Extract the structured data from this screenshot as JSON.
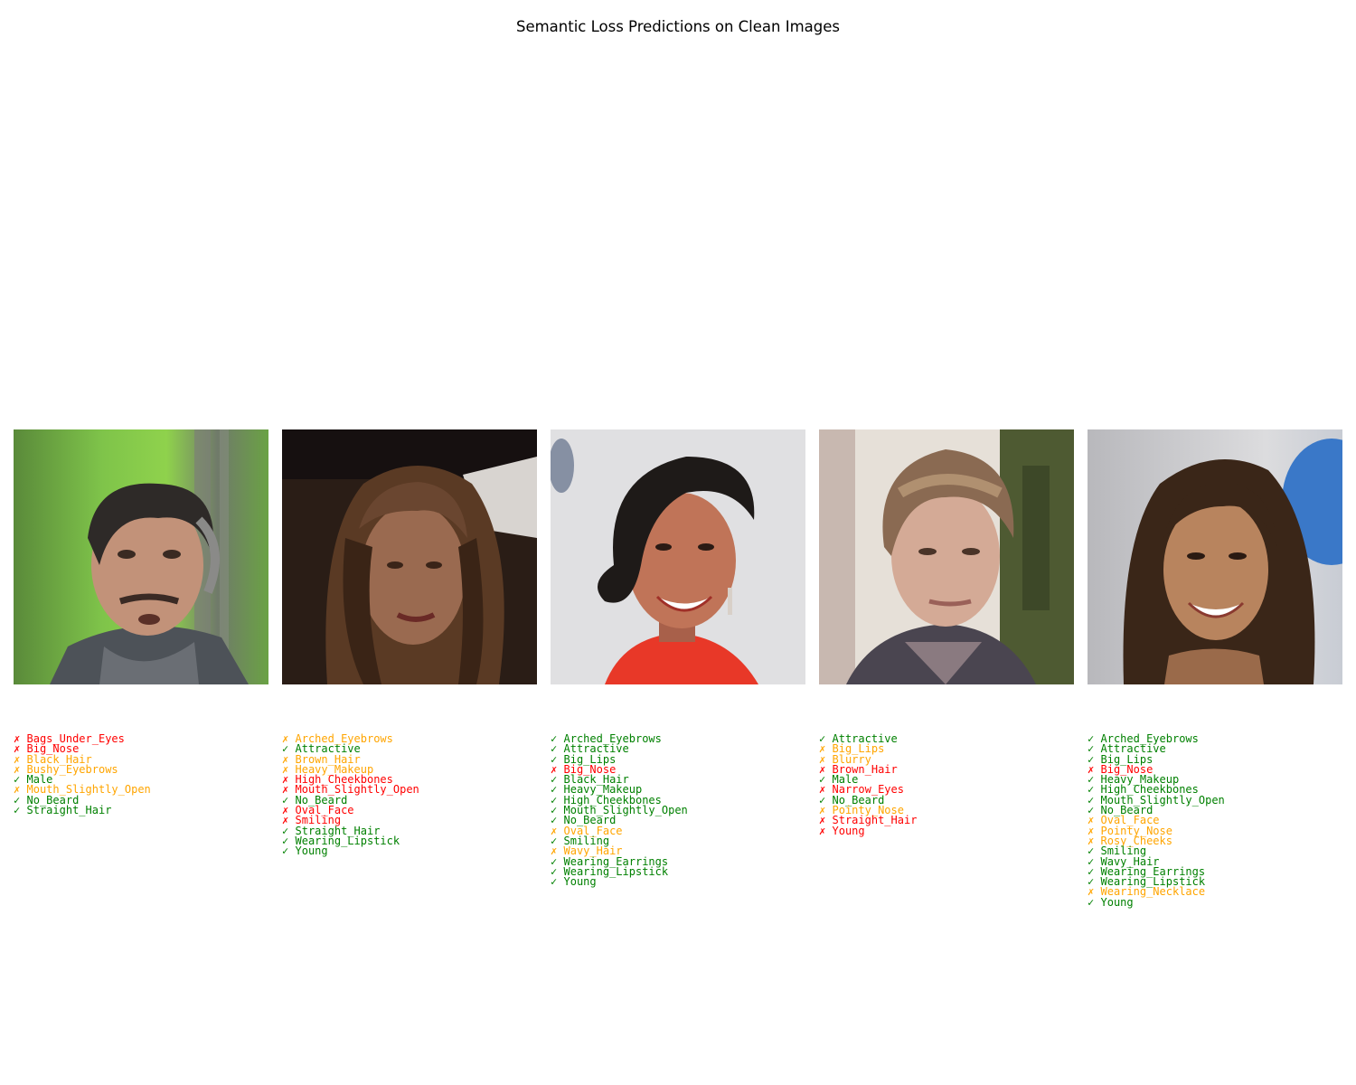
{
  "title": "Semantic Loss Predictions on Clean Images",
  "colors": {
    "correct": "#008000",
    "partial": "#ffa500",
    "wrong": "#ff0000"
  },
  "chart_data": {
    "type": "image-grid",
    "title": "Semantic Loss Predictions on Clean Images",
    "legend": "none",
    "panels": [
      {
        "image": "face-photo-older-man",
        "labels": [
          {
            "mark": "✗",
            "text": "Bags_Under_Eyes",
            "status": "wrong"
          },
          {
            "mark": "✗",
            "text": "Big_Nose",
            "status": "wrong"
          },
          {
            "mark": "✗",
            "text": "Black_Hair",
            "status": "partial"
          },
          {
            "mark": "✗",
            "text": "Bushy_Eyebrows",
            "status": "partial"
          },
          {
            "mark": "✓",
            "text": "Male",
            "status": "correct"
          },
          {
            "mark": "✗",
            "text": "Mouth_Slightly_Open",
            "status": "partial"
          },
          {
            "mark": "✓",
            "text": "No_Beard",
            "status": "correct"
          },
          {
            "mark": "✓",
            "text": "Straight_Hair",
            "status": "correct"
          }
        ]
      },
      {
        "image": "face-photo-young-woman-long-hair",
        "labels": [
          {
            "mark": "✗",
            "text": "Arched_Eyebrows",
            "status": "partial"
          },
          {
            "mark": "✓",
            "text": "Attractive",
            "status": "correct"
          },
          {
            "mark": "✗",
            "text": "Brown_Hair",
            "status": "partial"
          },
          {
            "mark": "✗",
            "text": "Heavy_Makeup",
            "status": "partial"
          },
          {
            "mark": "✗",
            "text": "High_Cheekbones",
            "status": "wrong"
          },
          {
            "mark": "✗",
            "text": "Mouth_Slightly_Open",
            "status": "wrong"
          },
          {
            "mark": "✓",
            "text": "No_Beard",
            "status": "correct"
          },
          {
            "mark": "✗",
            "text": "Oval_Face",
            "status": "wrong"
          },
          {
            "mark": "✗",
            "text": "Smiling",
            "status": "wrong"
          },
          {
            "mark": "✓",
            "text": "Straight_Hair",
            "status": "correct"
          },
          {
            "mark": "✓",
            "text": "Wearing_Lipstick",
            "status": "correct"
          },
          {
            "mark": "✓",
            "text": "Young",
            "status": "correct"
          }
        ]
      },
      {
        "image": "face-photo-smiling-woman-red-top",
        "labels": [
          {
            "mark": "✓",
            "text": "Arched_Eyebrows",
            "status": "correct"
          },
          {
            "mark": "✓",
            "text": "Attractive",
            "status": "correct"
          },
          {
            "mark": "✓",
            "text": "Big_Lips",
            "status": "correct"
          },
          {
            "mark": "✗",
            "text": "Big_Nose",
            "status": "wrong"
          },
          {
            "mark": "✓",
            "text": "Black_Hair",
            "status": "correct"
          },
          {
            "mark": "✓",
            "text": "Heavy_Makeup",
            "status": "correct"
          },
          {
            "mark": "✓",
            "text": "High_Cheekbones",
            "status": "correct"
          },
          {
            "mark": "✓",
            "text": "Mouth_Slightly_Open",
            "status": "correct"
          },
          {
            "mark": "✓",
            "text": "No_Beard",
            "status": "correct"
          },
          {
            "mark": "✗",
            "text": "Oval_Face",
            "status": "partial"
          },
          {
            "mark": "✓",
            "text": "Smiling",
            "status": "correct"
          },
          {
            "mark": "✗",
            "text": "Wavy_Hair",
            "status": "partial"
          },
          {
            "mark": "✓",
            "text": "Wearing_Earrings",
            "status": "correct"
          },
          {
            "mark": "✓",
            "text": "Wearing_Lipstick",
            "status": "correct"
          },
          {
            "mark": "✓",
            "text": "Young",
            "status": "correct"
          }
        ]
      },
      {
        "image": "face-photo-young-man",
        "labels": [
          {
            "mark": "✓",
            "text": "Attractive",
            "status": "correct"
          },
          {
            "mark": "✗",
            "text": "Big_Lips",
            "status": "partial"
          },
          {
            "mark": "✗",
            "text": "Blurry",
            "status": "partial"
          },
          {
            "mark": "✗",
            "text": "Brown_Hair",
            "status": "wrong"
          },
          {
            "mark": "✓",
            "text": "Male",
            "status": "correct"
          },
          {
            "mark": "✗",
            "text": "Narrow_Eyes",
            "status": "wrong"
          },
          {
            "mark": "✓",
            "text": "No_Beard",
            "status": "correct"
          },
          {
            "mark": "✗",
            "text": "Pointy_Nose",
            "status": "partial"
          },
          {
            "mark": "✗",
            "text": "Straight_Hair",
            "status": "wrong"
          },
          {
            "mark": "✗",
            "text": "Young",
            "status": "wrong"
          }
        ]
      },
      {
        "image": "face-photo-smiling-woman-wavy-hair",
        "labels": [
          {
            "mark": "✓",
            "text": "Arched_Eyebrows",
            "status": "correct"
          },
          {
            "mark": "✓",
            "text": "Attractive",
            "status": "correct"
          },
          {
            "mark": "✓",
            "text": "Big_Lips",
            "status": "correct"
          },
          {
            "mark": "✗",
            "text": "Big_Nose",
            "status": "wrong"
          },
          {
            "mark": "✓",
            "text": "Heavy_Makeup",
            "status": "correct"
          },
          {
            "mark": "✓",
            "text": "High_Cheekbones",
            "status": "correct"
          },
          {
            "mark": "✓",
            "text": "Mouth_Slightly_Open",
            "status": "correct"
          },
          {
            "mark": "✓",
            "text": "No_Beard",
            "status": "correct"
          },
          {
            "mark": "✗",
            "text": "Oval_Face",
            "status": "partial"
          },
          {
            "mark": "✗",
            "text": "Pointy_Nose",
            "status": "partial"
          },
          {
            "mark": "✗",
            "text": "Rosy_Cheeks",
            "status": "partial"
          },
          {
            "mark": "✓",
            "text": "Smiling",
            "status": "correct"
          },
          {
            "mark": "✓",
            "text": "Wavy_Hair",
            "status": "correct"
          },
          {
            "mark": "✓",
            "text": "Wearing_Earrings",
            "status": "correct"
          },
          {
            "mark": "✓",
            "text": "Wearing_Lipstick",
            "status": "correct"
          },
          {
            "mark": "✗",
            "text": "Wearing_Necklace",
            "status": "partial"
          },
          {
            "mark": "✓",
            "text": "Young",
            "status": "correct"
          }
        ]
      }
    ]
  }
}
